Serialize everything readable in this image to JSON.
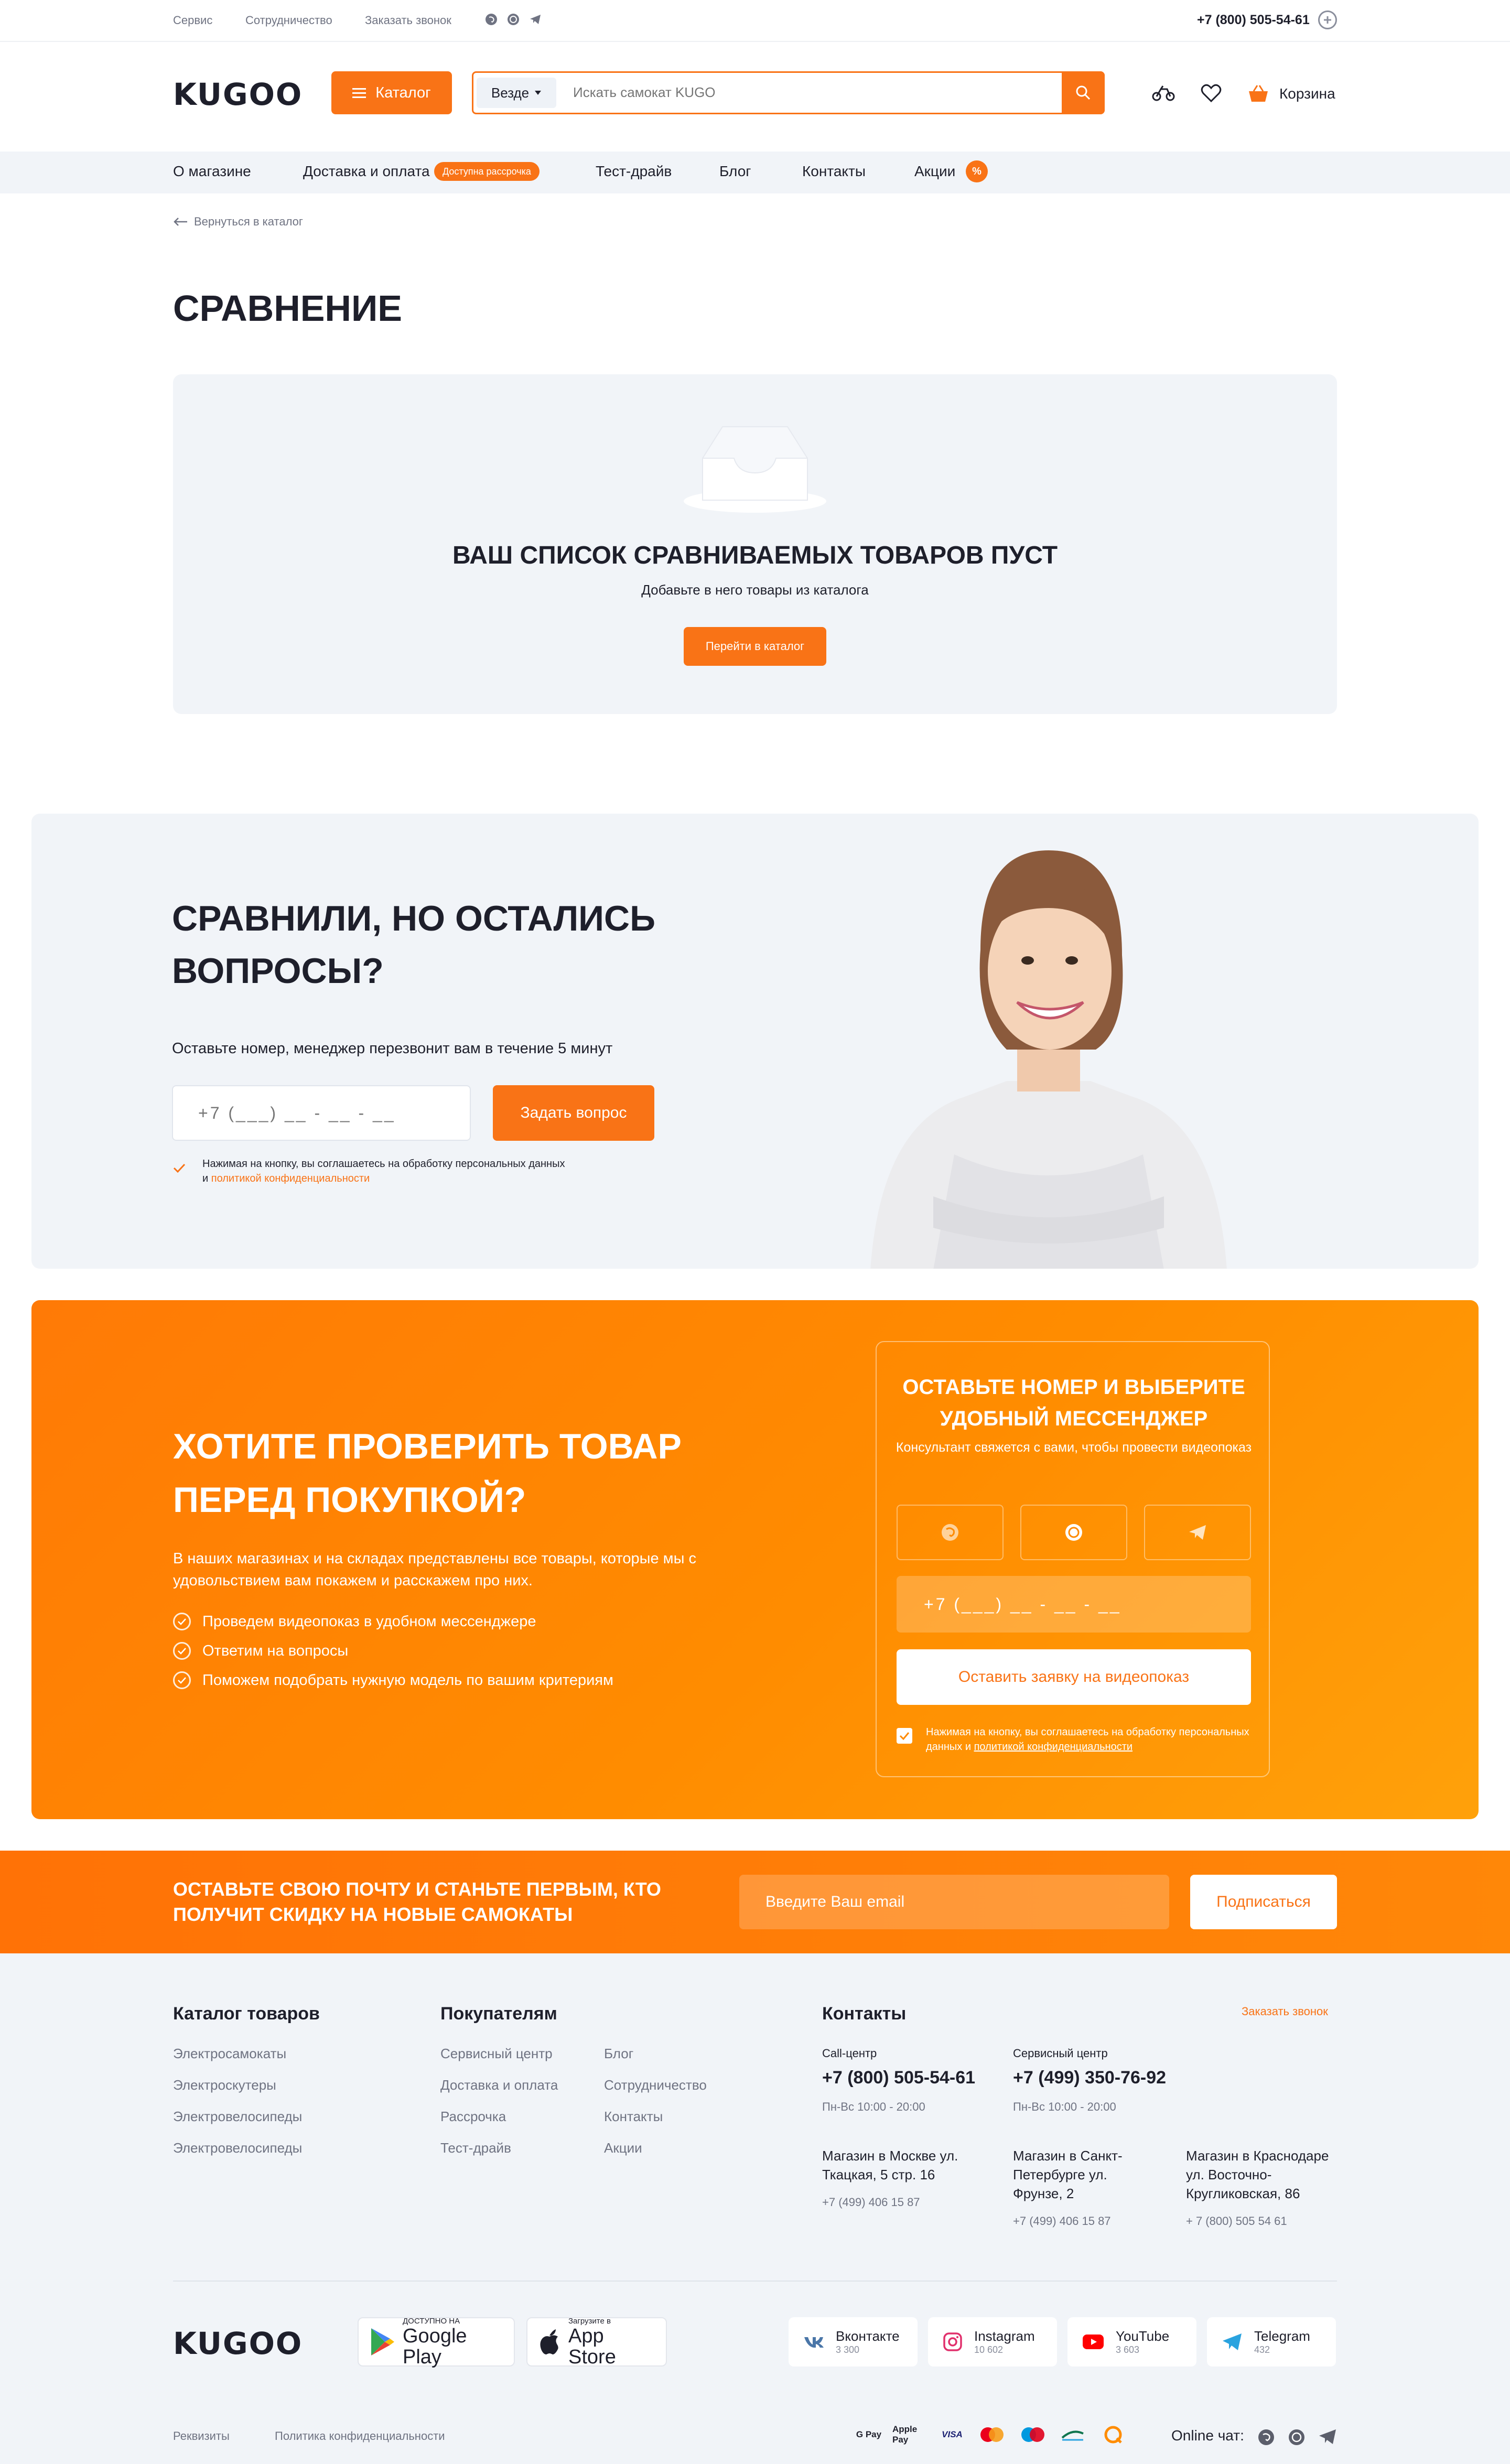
{
  "topbar": {
    "links": [
      "Сервис",
      "Сотрудничество",
      "Заказать звонок"
    ],
    "phone": "+7 (800) 505-54-61"
  },
  "header": {
    "logo": "KUGOO",
    "catalog_label": "Каталог",
    "search_scope": "Везде",
    "search_placeholder": "Искать самокат KUGO",
    "cart_label": "Корзина"
  },
  "nav": {
    "items": [
      "О магазине",
      "Доставка и оплата",
      "Тест-драйв",
      "Блог",
      "Контакты",
      "Акции"
    ],
    "installment_badge": "Доступна рассрочка",
    "sale_badge": "%"
  },
  "page": {
    "back_link": "Вернуться в каталог",
    "title": "СРАВНЕНИЕ"
  },
  "empty": {
    "title": "ВАШ СПИСОК СРАВНИВАЕМЫХ ТОВАРОВ ПУСТ",
    "subtitle": "Добавьте в него товары из каталога",
    "button": "Перейти в каталог"
  },
  "questions": {
    "title": "СРАВНИЛИ, НО ОСТАЛИСЬ ВОПРОСЫ?",
    "subtitle": "Оставьте номер, менеджер перезвонит вам в течение 5 минут",
    "phone_placeholder": "+7 (___) __ - __ - __",
    "button": "Задать вопрос",
    "consent_text": "Нажимая на кнопку, вы соглашаетесь на обработку персональных данных и",
    "consent_link": "политикой конфиденциальности"
  },
  "check_block": {
    "title": "ХОТИТЕ ПРОВЕРИТЬ ТОВАР ПЕРЕД ПОКУПКОЙ?",
    "text": "В наших магазинах и на складах представлены все товары, которые мы с удовольствием вам покажем и расскажем про них.",
    "list": [
      "Проведем видеопоказ в удобном мессенджере",
      "Ответим на вопросы",
      "Поможем подобрать нужную модель по вашим критериям"
    ],
    "card_title": "ОСТАВЬТЕ НОМЕР И ВЫБЕРИТЕ УДОБНЫЙ МЕССЕНДЖЕР",
    "card_sub": "Консультант свяжется с вами, чтобы провести видеопоказ",
    "messengers": [
      "viber-icon",
      "whatsapp-icon",
      "telegram-icon"
    ],
    "phone_placeholder": "+7 (___) __ - __ - __",
    "button": "Оставить заявку на видеопоказ",
    "consent_text": "Нажимая на кнопку, вы соглашаетесь на обработку персональных данных и",
    "consent_link": "политикой конфиденциальности"
  },
  "subscribe": {
    "title": "ОСТАВЬТЕ СВОЮ ПОЧТУ И СТАНЬТЕ ПЕРВЫМ, КТО ПОЛУЧИТ СКИДКУ НА НОВЫЕ САМОКАТЫ",
    "email_placeholder": "Введите Ваш email",
    "button": "Подписаться"
  },
  "footer": {
    "catalog_title": "Каталог товаров",
    "catalog_links": [
      "Электросамокаты",
      "Электроскутеры",
      "Электровелосипеды",
      "Электровелосипеды"
    ],
    "buyers_title": "Покупателям",
    "buyers_col1": [
      "Сервисный центр",
      "Доставка и оплата",
      "Рассрочка",
      "Тест-драйв"
    ],
    "buyers_col2": [
      "Блог",
      "Сотрудничество",
      "Контакты",
      "Акции"
    ],
    "contacts_title": "Контакты",
    "call_link": "Заказать звонок",
    "callcenter_label": "Call-центр",
    "callcenter_phone": "+7 (800) 505-54-61",
    "callcenter_hours": "Пн-Вс 10:00 - 20:00",
    "service_label": "Сервисный центр",
    "service_phone": "+7 (499) 350-76-92",
    "service_hours": "Пн-Вс 10:00 - 20:00",
    "stores": [
      {
        "address": "Магазин в Москве ул. Ткацкая, 5 стр. 16",
        "phone": "+7 (499) 406 15 87"
      },
      {
        "address": "Магазин в Санкт-Петербурге ул. Фрунзе, 2",
        "phone": "+7 (499) 406 15 87"
      },
      {
        "address": "Магазин в Краснодаре ул. Восточно-Кругликовская, 86",
        "phone": "+ 7 (800) 505 54 61"
      }
    ],
    "logo": "KUGOO",
    "google_small": "ДОСТУПНО НА",
    "google_big": "Google Play",
    "apple_small": "Загрузите в",
    "apple_big": "App Store",
    "socials": [
      {
        "name": "Вконтакте",
        "count": "3 300",
        "icon": "vk-icon",
        "color": "#4a76a8"
      },
      {
        "name": "Instagram",
        "count": "10 602",
        "icon": "instagram-icon",
        "color": "#e1306c"
      },
      {
        "name": "YouTube",
        "count": "3 603",
        "icon": "youtube-icon",
        "color": "#ff0000"
      },
      {
        "name": "Telegram",
        "count": "432",
        "icon": "telegram-icon",
        "color": "#2aa3df"
      }
    ],
    "requisites": "Реквизиты",
    "privacy": "Политика конфиденциальности",
    "payments": [
      "G Pay",
      "Apple Pay",
      "VISA",
      "mastercard-icon",
      "maestro-icon",
      "mir-icon",
      "qiwi-icon"
    ],
    "online_chat": "Online чат:"
  },
  "colors": {
    "accent": "#f97316",
    "text": "#1e1f2b",
    "muted": "#6f7382",
    "panel": "#f1f4f8"
  }
}
